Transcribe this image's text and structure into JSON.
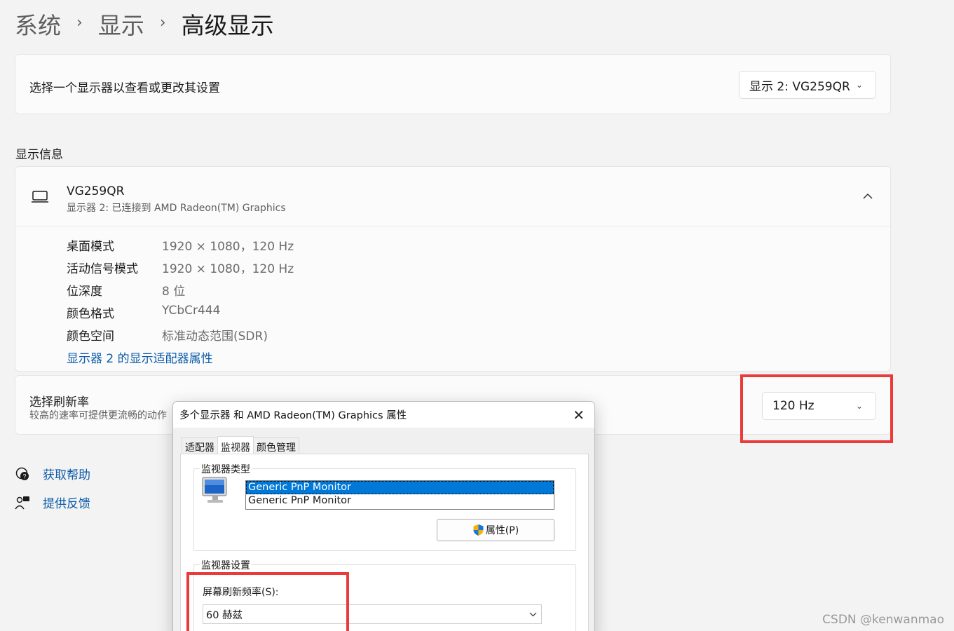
{
  "breadcrumb": {
    "level1": "系统",
    "level2": "显示",
    "current": "高级显示",
    "sep": "›"
  },
  "select_display": {
    "label": "选择一个显示器以查看或更改其设置",
    "value": "显示 2: VG259QR"
  },
  "section_title": "显示信息",
  "monitor": {
    "name": "VG259QR",
    "subtitle": "显示器 2: 已连接到 AMD Radeon(TM) Graphics",
    "rows": [
      {
        "key": "桌面模式",
        "value": "1920 × 1080，120 Hz"
      },
      {
        "key": "活动信号模式",
        "value": "1920 × 1080，120 Hz"
      },
      {
        "key": "位深度",
        "value": "8 位"
      },
      {
        "key": "颜色格式",
        "value": "YCbCr444"
      },
      {
        "key": "颜色空间",
        "value": "标准动态范围(SDR)"
      }
    ],
    "adapter_link": "显示器 2 的显示适配器属性"
  },
  "refresh": {
    "label": "选择刷新率",
    "description": "较高的速率可提供更流畅的动作",
    "value": "120 Hz"
  },
  "help": {
    "get_help": "获取帮助",
    "feedback": "提供反馈"
  },
  "dialog": {
    "title": "多个显示器 和 AMD Radeon(TM) Graphics 属性",
    "tabs": [
      "适配器",
      "监视器",
      "颜色管理"
    ],
    "monitor_type_title": "监视器类型",
    "monitor_list": [
      "Generic PnP Monitor",
      "Generic PnP Monitor"
    ],
    "properties_button": "属性(P)",
    "monitor_settings_title": "监视器设置",
    "refresh_rate_label": "屏幕刷新频率(S):",
    "refresh_rate_value": "60 赫兹"
  },
  "watermark": "CSDN @kenwanmao",
  "colors": {
    "accent": "#0a5aa8",
    "highlight": "#ea3a3a",
    "selection": "#0078d7"
  }
}
